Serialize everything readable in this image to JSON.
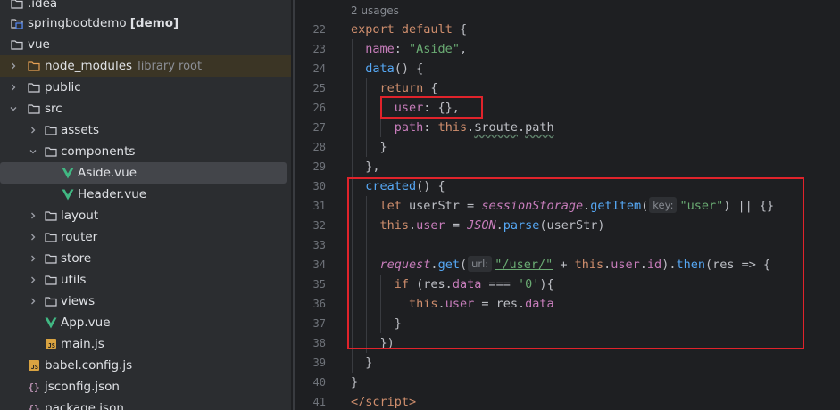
{
  "tree": {
    "items": [
      {
        "label": ".idea",
        "hint": "",
        "bold": ""
      },
      {
        "label": "springbootdemo",
        "hint": "",
        "bold": "[demo]"
      },
      {
        "label": "vue",
        "hint": "",
        "bold": ""
      },
      {
        "label": "node_modules",
        "hint": "library root",
        "bold": ""
      },
      {
        "label": "public",
        "hint": "",
        "bold": ""
      },
      {
        "label": "src",
        "hint": "",
        "bold": ""
      },
      {
        "label": "assets",
        "hint": "",
        "bold": ""
      },
      {
        "label": "components",
        "hint": "",
        "bold": ""
      },
      {
        "label": "Aside.vue",
        "hint": "",
        "bold": ""
      },
      {
        "label": "Header.vue",
        "hint": "",
        "bold": ""
      },
      {
        "label": "layout",
        "hint": "",
        "bold": ""
      },
      {
        "label": "router",
        "hint": "",
        "bold": ""
      },
      {
        "label": "store",
        "hint": "",
        "bold": ""
      },
      {
        "label": "utils",
        "hint": "",
        "bold": ""
      },
      {
        "label": "views",
        "hint": "",
        "bold": ""
      },
      {
        "label": "App.vue",
        "hint": "",
        "bold": ""
      },
      {
        "label": "main.js",
        "hint": "",
        "bold": ""
      },
      {
        "label": "babel.config.js",
        "hint": "",
        "bold": ""
      },
      {
        "label": "jsconfig.json",
        "hint": "",
        "bold": ""
      },
      {
        "label": "package.json",
        "hint": "",
        "bold": ""
      }
    ],
    "js_badge": "JS",
    "json_badge": "{}"
  },
  "editor": {
    "usages": "2 usages",
    "line_numbers": [
      "22",
      "23",
      "24",
      "25",
      "26",
      "27",
      "28",
      "29",
      "30",
      "31",
      "32",
      "33",
      "34",
      "35",
      "36",
      "37",
      "38",
      "39",
      "40",
      "41"
    ],
    "tokens": {
      "export": "export",
      "default": "default",
      "brace_open": " {",
      "name_key": "name",
      "colon_space": ": ",
      "name_val": "\"Aside\"",
      "comma": ",",
      "data_fn": "data",
      "parens_brace": "() {",
      "return_kw": "return",
      "user_key": "user",
      "user_val": ": {},",
      "path_key": "path",
      "this_kw": "this",
      "dot": ".",
      "route": "$route",
      "path_prop": "path",
      "close_brace": "}",
      "close_brace_comma": "},",
      "created_fn": "created",
      "let_kw": "let",
      "userStr_decl": " userStr = ",
      "sessionStorage": "sessionStorage",
      "getItem": "getItem",
      "open_paren": "(",
      "key_hint": "key:",
      "user_str": "\"user\"",
      "close_or_brace": ") || {}",
      "user_prop": "user",
      "assign": " = ",
      "JSON": "JSON",
      "parse": "parse",
      "userStr_arg": "(userStr)",
      "request": "request",
      "get": "get",
      "url_hint": "url:",
      "url_str": "\"/user/\"",
      "plus": " + ",
      "id_prop": "id",
      "close_paren_dot": ").",
      "then": "then",
      "res_arrow": "(res => {",
      "if_kw": "if",
      "if_open": " (res.",
      "data_prop": "data",
      "strict_eq": " === ",
      "zero_str": "'0'",
      "if_close": "){",
      "res_data": " = res.",
      "close_paren": "})",
      "script_close_open": "</",
      "script_tag": "script",
      "script_gt": ">"
    }
  },
  "colors": {
    "highlight_box": "#e0232b",
    "tree_background": "#2b2d30",
    "editor_background": "#1e1f22",
    "keyword": "#cf8e6d",
    "property": "#c77dbb",
    "string": "#6aab73",
    "function": "#56a8f5"
  },
  "icons": [
    "folder-icon",
    "module-icon",
    "vue-icon",
    "js-file-icon",
    "json-file-icon",
    "chevron-right-icon",
    "chevron-down-icon"
  ]
}
